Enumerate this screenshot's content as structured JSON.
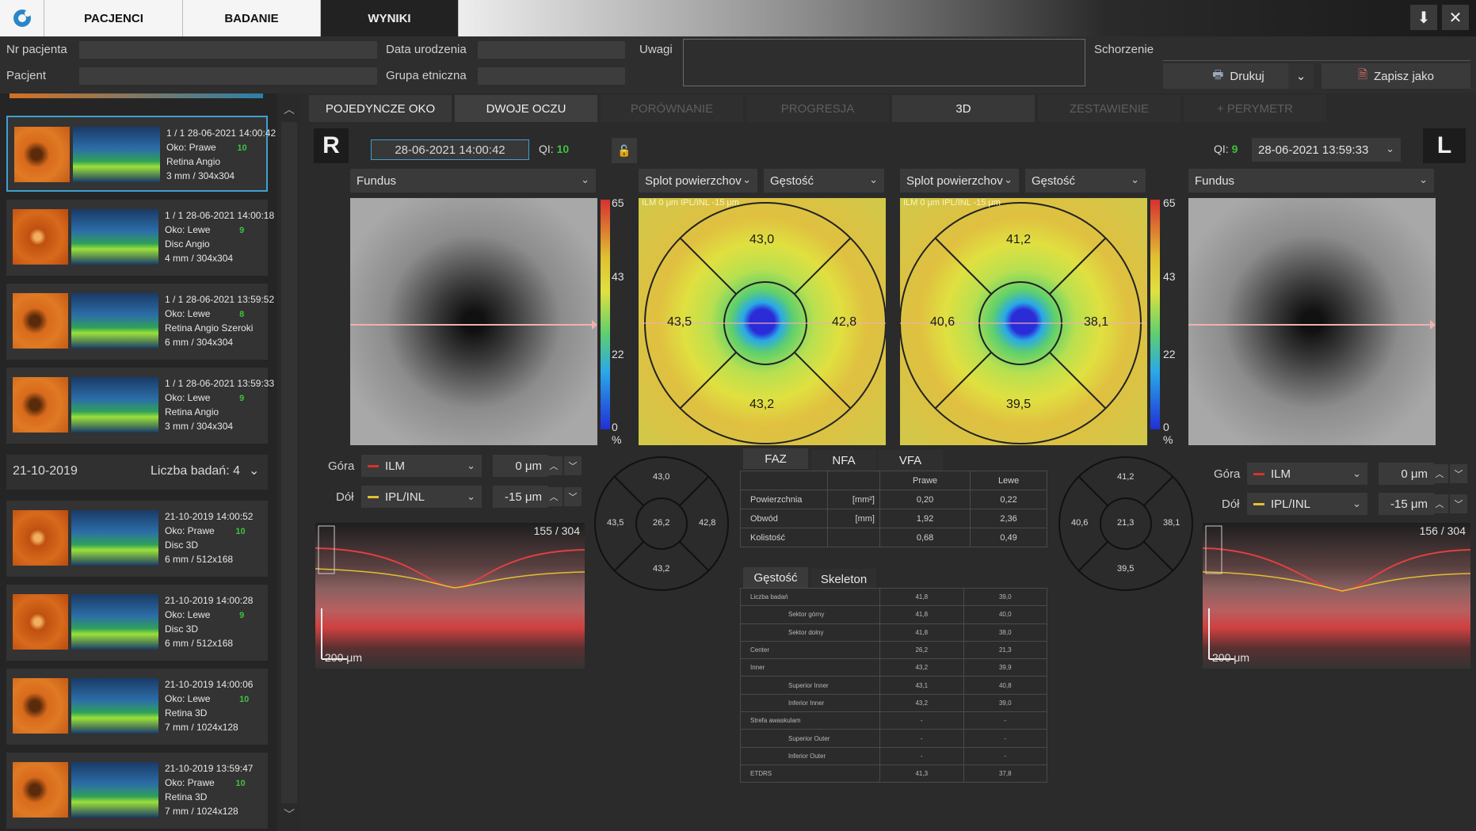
{
  "topbar": {
    "tabs": [
      {
        "label": "PACJENCI"
      },
      {
        "label": "BADANIE"
      },
      {
        "label": "WYNIKI"
      }
    ]
  },
  "patient": {
    "nr_label": "Nr pacjenta",
    "patient_label": "Pacjent",
    "dob_label": "Data urodzenia",
    "ethnic_label": "Grupa etniczna",
    "notes_label": "Uwagi",
    "disease_label": "Schorzenie",
    "print_label": "Drukuj",
    "saveas_label": "Zapisz jako"
  },
  "sessions": [
    {
      "date": "28-06-2021 14:00:42",
      "idx": "1 / 1",
      "eye": "Oko: Prawe",
      "qi": "10",
      "protocol": "Retina Angio",
      "size": "3 mm / 304x304"
    },
    {
      "date": "28-06-2021 14:00:18",
      "idx": "1 / 1",
      "eye": "Oko: Lewe",
      "qi": "9",
      "protocol": "Disc Angio",
      "size": "4 mm / 304x304"
    },
    {
      "date": "28-06-2021 13:59:52",
      "idx": "1 / 1",
      "eye": "Oko: Lewe",
      "qi": "8",
      "protocol": "Retina Angio Szeroki",
      "size": "6 mm / 304x304"
    },
    {
      "date": "28-06-2021 13:59:33",
      "idx": "1 / 1",
      "eye": "Oko: Lewe",
      "qi": "9",
      "protocol": "Retina Angio",
      "size": "3 mm / 304x304"
    },
    {
      "date": "21-10-2019 14:00:52",
      "idx": "",
      "eye": "Oko: Prawe",
      "qi": "10",
      "protocol": "Disc 3D",
      "size": "6 mm / 512x168"
    },
    {
      "date": "21-10-2019 14:00:28",
      "idx": "",
      "eye": "Oko: Lewe",
      "qi": "9",
      "protocol": "Disc 3D",
      "size": "6 mm / 512x168"
    },
    {
      "date": "21-10-2019 14:00:06",
      "idx": "",
      "eye": "Oko: Lewe",
      "qi": "10",
      "protocol": "Retina 3D",
      "size": "7 mm / 1024x128"
    },
    {
      "date": "21-10-2019 13:59:47",
      "idx": "",
      "eye": "Oko: Prawe",
      "qi": "10",
      "protocol": "Retina 3D",
      "size": "7 mm / 1024x128"
    }
  ],
  "group": {
    "date": "21-10-2019",
    "count_label": "Liczba badań: 4"
  },
  "view_tabs": [
    "POJEDYNCZE OKO",
    "DWOJE OCZU",
    "PORÓWNANIE",
    "PROGRESJA",
    "3D",
    "ZESTAWIENIE",
    "+ PERYMETR"
  ],
  "right_eye": {
    "letter": "R",
    "date": "28-06-2021 14:00:42",
    "qi_label": "QI:",
    "qi": "10",
    "fundus_dd": "Fundus",
    "layer_dd": "Splot powierzchov",
    "metric_dd": "Gęstość",
    "top_label": "Góra",
    "top_layer": "ILM",
    "top_offset": "0 μm",
    "bottom_label": "Dół",
    "bottom_layer": "IPL/INL",
    "bottom_offset": "-15 μm",
    "bscan_idx": "155 / 304",
    "bscan_scale": "200 μm",
    "overlay_text": "ILM 0 μm   IPL/INL  -15 μm",
    "sectors": {
      "top": "43,0",
      "left": "43,5",
      "right": "42,8",
      "bottom": "43,2",
      "center": "26,2"
    }
  },
  "left_eye": {
    "letter": "L",
    "date": "28-06-2021 13:59:33",
    "qi_label": "QI:",
    "qi": "9",
    "fundus_dd": "Fundus",
    "layer_dd": "Splot powierzchov",
    "metric_dd": "Gęstość",
    "top_label": "Góra",
    "top_layer": "ILM",
    "top_offset": "0 μm",
    "bottom_label": "Dół",
    "bottom_layer": "IPL/INL",
    "bottom_offset": "-15 μm",
    "bscan_idx": "156 / 304",
    "bscan_scale": "200 μm",
    "overlay_text": "ILM 0 μm   IPL/INL  -15 μm",
    "sectors": {
      "top": "41,2",
      "left": "40,6",
      "right": "38,1",
      "bottom": "39,5",
      "center": "21,3"
    }
  },
  "colorbar": {
    "max": "65",
    "mid1": "43",
    "mid2": "22",
    "min": "0",
    "unit": "%"
  },
  "faz_tabs": [
    "FAZ",
    "NFA",
    "VFA"
  ],
  "faz_table": {
    "headers": [
      "",
      "",
      "Prawe",
      "Lewe"
    ],
    "rows": [
      [
        "Powierzchnia",
        "[mm²]",
        "0,20",
        "0,22"
      ],
      [
        "Obwód",
        "[mm]",
        "1,92",
        "2,36"
      ],
      [
        "Kolistość",
        "",
        "0,68",
        "0,49"
      ]
    ]
  },
  "density_tabs": [
    "Gęstość",
    "Skeleton"
  ],
  "density_table": {
    "rows": [
      [
        "Liczba badań",
        "41,8",
        "39,0"
      ],
      [
        "Sektor górny",
        "41,8",
        "40,0"
      ],
      [
        "Sektor dolny",
        "41,8",
        "38,0"
      ],
      [
        "Center",
        "26,2",
        "21,3"
      ],
      [
        "Inner",
        "43,2",
        "39,9"
      ],
      [
        "Superior Inner",
        "43,1",
        "40,8"
      ],
      [
        "Inferior Inner",
        "43,2",
        "39,0"
      ],
      [
        "Strefa awaskulam",
        "-",
        "-"
      ],
      [
        "Superior Outer",
        "-",
        "-"
      ],
      [
        "Inferior Outer",
        "-",
        "-"
      ],
      [
        "ETDRS",
        "41,3",
        "37,8"
      ]
    ]
  },
  "colors": {
    "accent": "#3fa0d0",
    "qi": "#3ec23e",
    "bg": "#2b2b2b"
  }
}
